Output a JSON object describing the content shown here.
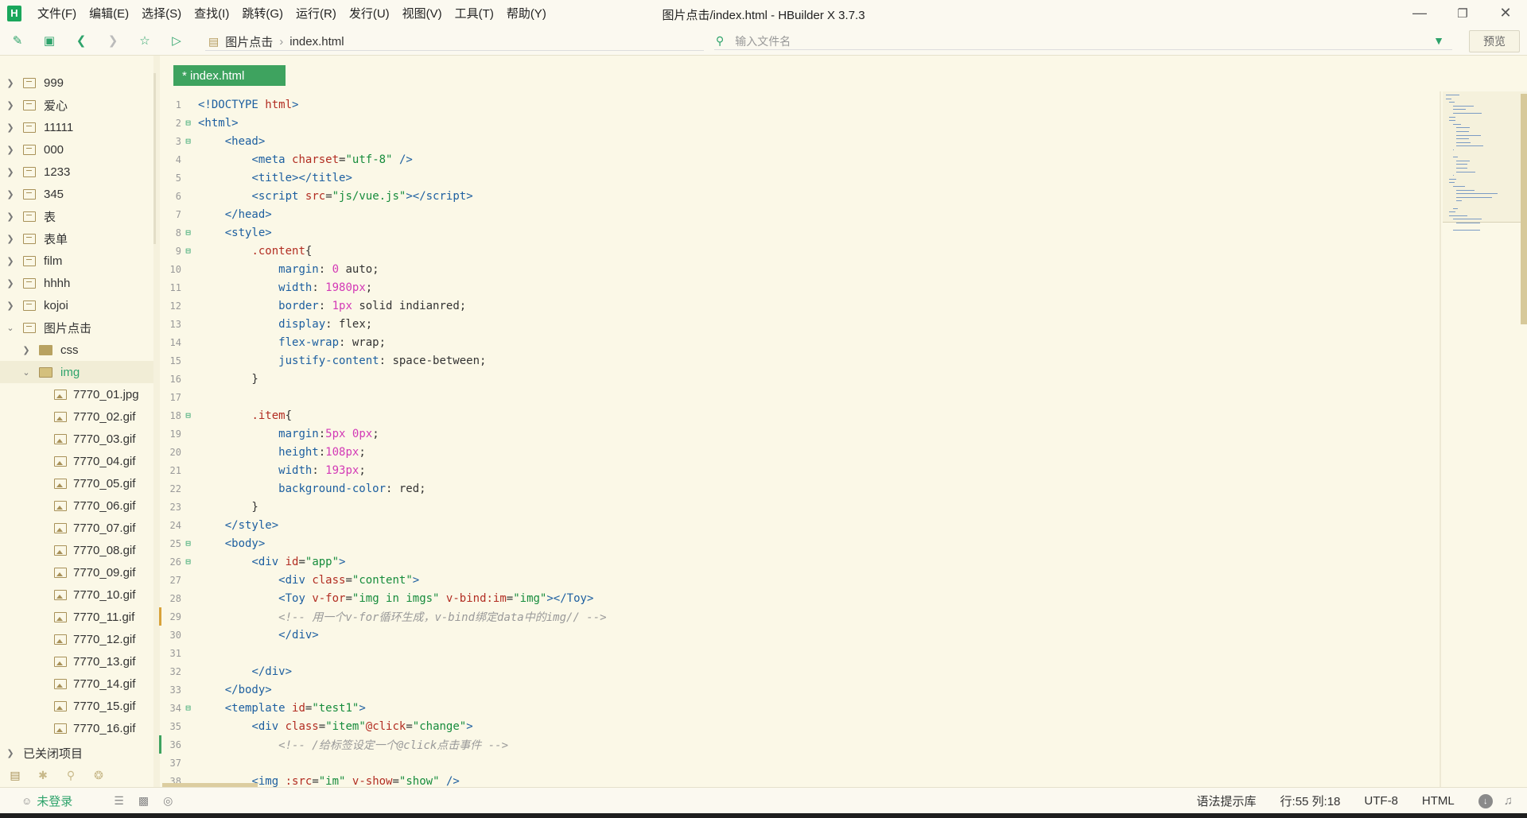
{
  "app": {
    "window_title": "图片点击/index.html - HBuilder X 3.7.3",
    "logo": "H"
  },
  "menu": [
    "文件(F)",
    "编辑(E)",
    "选择(S)",
    "查找(I)",
    "跳转(G)",
    "运行(R)",
    "发行(U)",
    "视图(V)",
    "工具(T)",
    "帮助(Y)"
  ],
  "toolbar": {
    "breadcrumb": [
      "图片点击",
      "index.html"
    ],
    "search_placeholder": "输入文件名",
    "preview_label": "预览"
  },
  "sidebar": {
    "projects": [
      "999",
      "爱心",
      "11111",
      "000",
      "1233",
      "345",
      "表",
      "表单",
      "film",
      "hhhh",
      "kojoi"
    ],
    "open_project": "图片点击",
    "folders": [
      "css",
      "img"
    ],
    "files": [
      "7770_01.jpg",
      "7770_02.gif",
      "7770_03.gif",
      "7770_04.gif",
      "7770_05.gif",
      "7770_06.gif",
      "7770_07.gif",
      "7770_08.gif",
      "7770_09.gif",
      "7770_10.gif",
      "7770_11.gif",
      "7770_12.gif",
      "7770_13.gif",
      "7770_14.gif",
      "7770_15.gif",
      "7770_16.gif"
    ],
    "closed_projects": "已关闭项目"
  },
  "editor": {
    "tab_label": "* index.html"
  },
  "code": [
    {
      "n": "1",
      "f": "",
      "html": "<span class=\"tag\">&lt;!DOCTYPE</span> <span class=\"attr\">html</span><span class=\"tag\">&gt;</span>"
    },
    {
      "n": "2",
      "f": "⊟",
      "html": "<span class=\"tag\">&lt;html&gt;</span>"
    },
    {
      "n": "3",
      "f": "⊟",
      "html": "    <span class=\"tag\">&lt;head&gt;</span>"
    },
    {
      "n": "4",
      "f": "",
      "html": "        <span class=\"tag\">&lt;meta</span> <span class=\"attr\">charset</span>=<span class=\"str\">\"utf-8\"</span> <span class=\"tag\">/&gt;</span>"
    },
    {
      "n": "5",
      "f": "",
      "html": "        <span class=\"tag\">&lt;title&gt;&lt;/title&gt;</span>"
    },
    {
      "n": "6",
      "f": "",
      "html": "        <span class=\"tag\">&lt;script</span> <span class=\"attr\">src</span>=<span class=\"str\">\"js/vue.js\"</span><span class=\"tag\">&gt;&lt;/script&gt;</span>"
    },
    {
      "n": "7",
      "f": "",
      "html": "    <span class=\"tag\">&lt;/head&gt;</span>"
    },
    {
      "n": "8",
      "f": "⊟",
      "html": "    <span class=\"tag\">&lt;style&gt;</span>"
    },
    {
      "n": "9",
      "f": "⊟",
      "html": "        <span class=\"sel\">.content</span>{"
    },
    {
      "n": "10",
      "f": "",
      "html": "            <span class=\"prop\">margin</span>: <span class=\"num\">0</span> auto;"
    },
    {
      "n": "11",
      "f": "",
      "html": "            <span class=\"prop\">width</span>: <span class=\"num\">1980px</span>;"
    },
    {
      "n": "12",
      "f": "",
      "html": "            <span class=\"prop\">border</span>: <span class=\"num\">1px</span> solid indianred;"
    },
    {
      "n": "13",
      "f": "",
      "html": "            <span class=\"prop\">display</span>: flex;"
    },
    {
      "n": "14",
      "f": "",
      "html": "            <span class=\"prop\">flex-wrap</span>: wrap;"
    },
    {
      "n": "15",
      "f": "",
      "html": "            <span class=\"prop\">justify-content</span>: space-between;"
    },
    {
      "n": "16",
      "f": "",
      "html": "        }"
    },
    {
      "n": "17",
      "f": "",
      "html": ""
    },
    {
      "n": "18",
      "f": "⊟",
      "html": "        <span class=\"sel\">.item</span>{"
    },
    {
      "n": "19",
      "f": "",
      "html": "            <span class=\"prop\">margin</span>:<span class=\"num\">5px</span> <span class=\"num\">0px</span>;"
    },
    {
      "n": "20",
      "f": "",
      "html": "            <span class=\"prop\">height</span>:<span class=\"num\">108px</span>;"
    },
    {
      "n": "21",
      "f": "",
      "html": "            <span class=\"prop\">width</span>: <span class=\"num\">193px</span>;"
    },
    {
      "n": "22",
      "f": "",
      "html": "            <span class=\"prop\">background-color</span>: red;"
    },
    {
      "n": "23",
      "f": "",
      "html": "        }"
    },
    {
      "n": "24",
      "f": "",
      "html": "    <span class=\"tag\">&lt;/style&gt;</span>"
    },
    {
      "n": "25",
      "f": "⊟",
      "html": "    <span class=\"tag\">&lt;body&gt;</span>"
    },
    {
      "n": "26",
      "f": "⊟",
      "html": "        <span class=\"tag\">&lt;div</span> <span class=\"attr\">id</span>=<span class=\"str\">\"app\"</span><span class=\"tag\">&gt;</span>"
    },
    {
      "n": "27",
      "f": "",
      "html": "            <span class=\"tag\">&lt;div</span> <span class=\"attr\">class</span>=<span class=\"str\">\"content\"</span><span class=\"tag\">&gt;</span>"
    },
    {
      "n": "28",
      "f": "",
      "html": "            <span class=\"tag\">&lt;Toy</span> <span class=\"attr\">v-for</span>=<span class=\"str\">\"img in imgs\"</span> <span class=\"attr\">v-bind:im</span>=<span class=\"str\">\"img\"</span><span class=\"tag\">&gt;&lt;/Toy&gt;</span>"
    },
    {
      "n": "29",
      "f": "",
      "html": "            <span class=\"cmt\">&lt;!-- 用一个v-for循环生成，v-bind绑定data中的img// --&gt;</span>"
    },
    {
      "n": "30",
      "f": "",
      "html": "            <span class=\"tag\">&lt;/div&gt;</span>"
    },
    {
      "n": "31",
      "f": "",
      "html": ""
    },
    {
      "n": "32",
      "f": "",
      "html": "        <span class=\"tag\">&lt;/div&gt;</span>"
    },
    {
      "n": "33",
      "f": "",
      "html": "    <span class=\"tag\">&lt;/body&gt;</span>"
    },
    {
      "n": "34",
      "f": "⊟",
      "html": "    <span class=\"tag\">&lt;template</span> <span class=\"attr\">id</span>=<span class=\"str\">\"test1\"</span><span class=\"tag\">&gt;</span>"
    },
    {
      "n": "35",
      "f": "",
      "html": "        <span class=\"tag\">&lt;div</span> <span class=\"attr\">class</span>=<span class=\"str\">\"item\"</span><span class=\"attr\">@click</span>=<span class=\"str\">\"change\"</span><span class=\"tag\">&gt;</span>"
    },
    {
      "n": "36",
      "f": "",
      "html": "            <span class=\"cmt\">&lt;!-- /给标签设定一个@click点击事件 --&gt;</span>"
    },
    {
      "n": "37",
      "f": "",
      "html": ""
    },
    {
      "n": "38",
      "f": "",
      "html": "        <span class=\"tag\">&lt;img</span> <span class=\"attr\">:src</span>=<span class=\"str\">\"im\"</span> <span class=\"attr\">v-show</span>=<span class=\"str\">\"show\"</span> <span class=\"tag\">/&gt;</span>"
    }
  ],
  "statusbar": {
    "login": "未登录",
    "syntax": "语法提示库",
    "position": "行:55  列:18",
    "encoding": "UTF-8",
    "language": "HTML"
  }
}
